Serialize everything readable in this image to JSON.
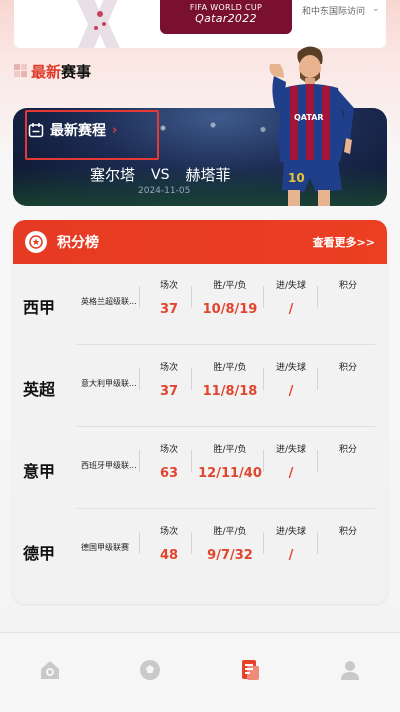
{
  "banner": {
    "fifa_line1": "FIFA WORLD CUP",
    "fifa_line2": "Qatar2022",
    "right_text": "和中东国际访问"
  },
  "section": {
    "title_red": "最新",
    "title_black": "赛事"
  },
  "hero": {
    "header": "最新赛程",
    "home_team": "塞尔塔",
    "vs": "VS",
    "away_team": "赫塔菲",
    "date": "2024-11-05"
  },
  "standings": {
    "title": "积分榜",
    "more": "查看更多>>",
    "col_labels": [
      "场次",
      "胜/平/负",
      "进/失球",
      "积分"
    ],
    "rows": [
      {
        "league": "西甲",
        "sub": "英格兰超级联...",
        "played": "37",
        "wdl": "10/8/19",
        "goals": "/",
        "points": ""
      },
      {
        "league": "英超",
        "sub": "意大利甲级联...",
        "played": "37",
        "wdl": "11/8/18",
        "goals": "/",
        "points": ""
      },
      {
        "league": "意甲",
        "sub": "西班牙甲级联...",
        "played": "63",
        "wdl": "12/11/40",
        "goals": "/",
        "points": ""
      },
      {
        "league": "德甲",
        "sub": "德国甲级联赛",
        "played": "48",
        "wdl": "9/7/32",
        "goals": "/",
        "points": ""
      }
    ]
  },
  "nav": {
    "items": [
      "home-icon",
      "ball-icon",
      "standings-icon",
      "profile-icon"
    ],
    "active_index": 2,
    "active_color": "#e8412b",
    "inactive_color": "#c9c9c9"
  },
  "colors": {
    "accent": "#e63a22",
    "value_red": "#e0452e"
  }
}
